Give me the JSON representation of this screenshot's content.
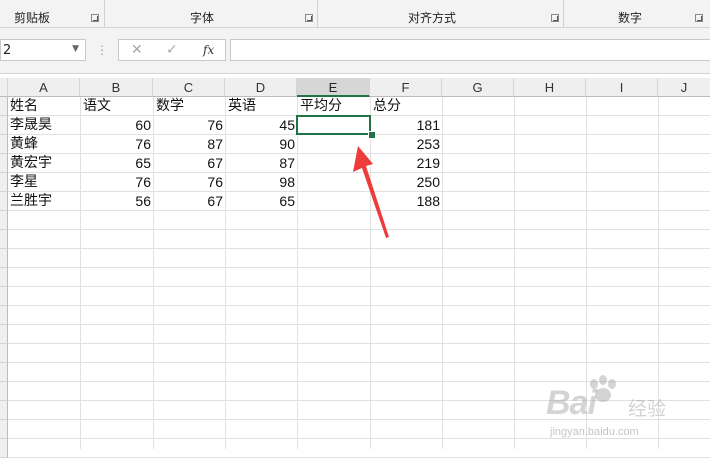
{
  "ribbon": {
    "groups": [
      {
        "label": "剪贴板"
      },
      {
        "label": "字体"
      },
      {
        "label": "对齐方式"
      },
      {
        "label": "数字"
      }
    ]
  },
  "formula_bar": {
    "name_box": "2",
    "cancel_icon": "✕",
    "enter_icon": "✓",
    "fx_label": "fx",
    "value": ""
  },
  "columns": [
    "A",
    "B",
    "C",
    "D",
    "E",
    "F",
    "G",
    "H",
    "I",
    "J"
  ],
  "selected_column": "E",
  "table": {
    "headers": [
      "姓名",
      "语文",
      "数学",
      "英语",
      "平均分",
      "总分"
    ],
    "rows": [
      {
        "name": "李晟昊",
        "chinese": "60",
        "math": "76",
        "english": "45",
        "average": "",
        "total": "181"
      },
      {
        "name": "黄蜂",
        "chinese": "76",
        "math": "87",
        "english": "90",
        "average": "",
        "total": "253"
      },
      {
        "name": "黄宏宇",
        "chinese": "65",
        "math": "67",
        "english": "87",
        "average": "",
        "total": "219"
      },
      {
        "name": "李星",
        "chinese": "76",
        "math": "76",
        "english": "98",
        "average": "",
        "total": "250"
      },
      {
        "name": "兰胜宇",
        "chinese": "56",
        "math": "67",
        "english": "65",
        "average": "",
        "total": "188"
      }
    ]
  },
  "watermark": {
    "brand": "Bai",
    "brand_suffix": "经验",
    "url": "jingyan.baidu.com"
  },
  "colors": {
    "selection": "#217346",
    "arrow": "#ee3b3b",
    "grid": "#e1e1e1"
  }
}
